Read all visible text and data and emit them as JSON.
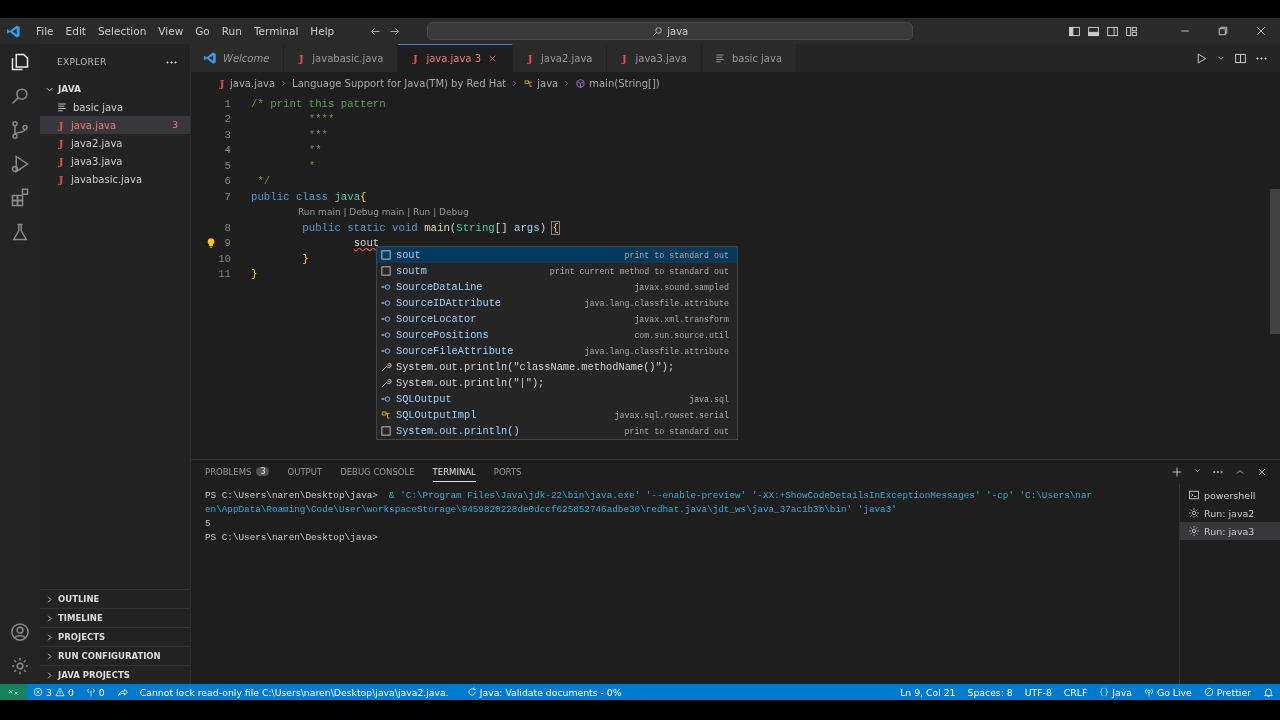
{
  "title_bar": {
    "menu": [
      "File",
      "Edit",
      "Selection",
      "View",
      "Go",
      "Run",
      "Terminal",
      "Help"
    ],
    "search": {
      "value": "java"
    }
  },
  "activity_bar": [
    {
      "selected": true
    },
    {
      "selected": false
    },
    {
      "selected": false
    },
    {
      "selected": false
    },
    {
      "selected": false
    },
    {
      "selected": false
    }
  ],
  "sidebar": {
    "title": "EXPLORER",
    "folder": {
      "name": "JAVA",
      "expanded": true,
      "children": [
        {
          "name": "basic java",
          "kind": "text",
          "selected": false,
          "error": false
        },
        {
          "name": "java.java",
          "kind": "java",
          "glyph": "J",
          "selected": true,
          "error": true,
          "badge": "3"
        },
        {
          "name": "java2.java",
          "kind": "java",
          "glyph": "J",
          "selected": false,
          "error": false
        },
        {
          "name": "java3.java",
          "kind": "java",
          "glyph": "J",
          "selected": false,
          "error": false
        },
        {
          "name": "javabasic.java",
          "kind": "java",
          "glyph": "J",
          "selected": false,
          "error": false
        }
      ]
    },
    "sections": [
      {
        "label": "OUTLINE",
        "expanded": false
      },
      {
        "label": "TIMELINE",
        "expanded": false
      },
      {
        "label": "PROJECTS",
        "expanded": false
      },
      {
        "label": "RUN CONFIGURATION",
        "expanded": false
      },
      {
        "label": "JAVA PROJECTS",
        "expanded": false
      }
    ]
  },
  "tabs": [
    {
      "label": "Welcome",
      "kind": "welcome",
      "selected": false,
      "error": false,
      "preview": true
    },
    {
      "label": "javabasic.java",
      "kind": "java",
      "glyph": "J",
      "selected": false,
      "error": false,
      "preview": false
    },
    {
      "label": "java.java",
      "kind": "java",
      "glyph": "J",
      "selected": true,
      "error": true,
      "preview": false,
      "badge": "3"
    },
    {
      "label": "java2.java",
      "kind": "java",
      "glyph": "J",
      "selected": false,
      "error": false,
      "preview": false
    },
    {
      "label": "java3.java",
      "kind": "java",
      "glyph": "J",
      "selected": false,
      "error": false,
      "preview": false
    },
    {
      "label": "basic java",
      "kind": "text",
      "selected": false,
      "error": false,
      "preview": false
    }
  ],
  "breadcrumb": [
    {
      "text": "java.java",
      "kind": "java",
      "glyph": "J"
    },
    {
      "text": "Language Support for Java(TM) by Red Hat"
    },
    {
      "text": "java",
      "kind": "class"
    },
    {
      "text": "main(String[])",
      "kind": "method"
    }
  ],
  "code": [
    {
      "number": "1",
      "tokens": [
        {
          "kind": "comment",
          "text": "/* print this pattern"
        }
      ]
    },
    {
      "number": "2",
      "tokens": [
        {
          "kind": "comment",
          "text": "         ****"
        }
      ]
    },
    {
      "number": "3",
      "tokens": [
        {
          "kind": "comment",
          "text": "         ***"
        }
      ]
    },
    {
      "number": "4",
      "tokens": [
        {
          "kind": "comment",
          "text": "         **"
        }
      ]
    },
    {
      "number": "5",
      "tokens": [
        {
          "kind": "comment",
          "text": "         *"
        }
      ]
    },
    {
      "number": "6",
      "tokens": [
        {
          "kind": "comment",
          "text": " */"
        }
      ]
    },
    {
      "number": "7",
      "tokens": [
        {
          "kind": "keyword",
          "text": "public class "
        },
        {
          "kind": "type",
          "text": "java"
        },
        {
          "kind": "bracket",
          "text": "{"
        }
      ]
    },
    {
      "number": "8",
      "codelens": "Run main | Debug main | Run | Debug",
      "tokens": [
        {
          "kind": "keyword",
          "text": "        public static void "
        },
        {
          "kind": "function",
          "text": "main"
        },
        {
          "kind": "plain",
          "text": "("
        },
        {
          "kind": "class",
          "text": "String"
        },
        {
          "kind": "plain",
          "text": "[] "
        },
        {
          "kind": "variable",
          "text": "args"
        },
        {
          "kind": "plain",
          "text": ") "
        },
        {
          "kind": "match",
          "text": "{"
        }
      ]
    },
    {
      "number": "9",
      "lightbulb": true,
      "tokens": [
        {
          "kind": "error",
          "text": "                sout"
        }
      ]
    },
    {
      "number": "10",
      "tokens": [
        {
          "kind": "bracket",
          "text": "        }"
        }
      ]
    },
    {
      "number": "11",
      "tokens": [
        {
          "kind": "bracket",
          "text": "}"
        }
      ]
    }
  ],
  "suggestions": [
    {
      "kind": "snippet",
      "label": "sout",
      "detail": "print to standard out",
      "selected": true
    },
    {
      "kind": "snippet",
      "label": "soutm",
      "detail": "print current method to standard out",
      "selected": false
    },
    {
      "kind": "interface",
      "label": "SourceDataLine",
      "detail": "javax.sound.sampled",
      "selected": false
    },
    {
      "kind": "interface",
      "label": "SourceIDAttribute",
      "detail": "java.lang.classfile.attribute",
      "selected": false
    },
    {
      "kind": "interface",
      "label": "SourceLocator",
      "detail": "javax.xml.transform",
      "selected": false
    },
    {
      "kind": "interface",
      "label": "SourcePositions",
      "detail": "com.sun.source.util",
      "selected": false
    },
    {
      "kind": "interface",
      "label": "SourceFileAttribute",
      "detail": "java.lang.classfile.attribute",
      "selected": false
    },
    {
      "kind": "wrench",
      "label": "System.out.println(\"className.methodName()\");",
      "selected": false
    },
    {
      "kind": "wrench",
      "label": "System.out.println(\"|\");",
      "selected": false
    },
    {
      "kind": "interface",
      "label": "SQLOutput",
      "detail": "java.sql",
      "selected": false
    },
    {
      "kind": "class",
      "label": "SQLOutputImpl",
      "detail": "javax.sql.rowset.serial",
      "selected": false
    },
    {
      "kind": "snippet",
      "label": "System.out.println()",
      "detail": "print to standard out",
      "selected": false
    }
  ],
  "panel": {
    "tabs": [
      {
        "label": "PROBLEMS",
        "badge": "3",
        "selected": false
      },
      {
        "label": "OUTPUT",
        "selected": false
      },
      {
        "label": "DEBUG CONSOLE",
        "selected": false
      },
      {
        "label": "TERMINAL",
        "selected": true
      },
      {
        "label": "PORTS",
        "selected": false
      }
    ],
    "terminal": [
      [
        {
          "kind": "prompt",
          "text": "PS C:\\Users\\naren\\Desktop\\java> "
        },
        {
          "kind": "command",
          "text": " & 'C:\\Program Files\\Java\\jdk-22\\bin\\java.exe' '--enable-preview' '-XX:+ShowCodeDetailsInExceptionMessages' '-cp' 'C:\\Users\\nar"
        }
      ],
      [
        {
          "kind": "command",
          "text": "en\\AppData\\Roaming\\Code\\User\\workspaceStorage\\9459820228de0dccf625852746adbe30\\redhat.java\\jdt_ws\\java_37ac1b3b\\bin' 'java3'"
        }
      ],
      [
        {
          "kind": "prompt",
          "text": "5"
        }
      ],
      [
        {
          "kind": "prompt",
          "text": "PS C:\\Users\\naren\\Desktop\\java>"
        }
      ]
    ],
    "sessions": [
      {
        "label": "powershell",
        "kind": "shell",
        "selected": false
      },
      {
        "label": "Run: java2",
        "kind": "run",
        "selected": false
      },
      {
        "label": "Run: java3",
        "kind": "run",
        "selected": true
      }
    ]
  },
  "status_bar": {
    "left": [
      {
        "kind": "remote"
      },
      {
        "kind": "problems",
        "errors": "3",
        "warnings": "0"
      },
      {
        "kind": "ports",
        "text": "0"
      },
      {
        "kind": "share"
      },
      {
        "kind": "message",
        "text": "Cannot lock read-only file C:\\Users\\naren\\Desktop\\java\\java2.java."
      },
      {
        "kind": "progress",
        "text": "Java: Validate documents - 0%"
      }
    ],
    "right": [
      {
        "kind": "text",
        "text": "Ln 9, Col 21"
      },
      {
        "kind": "text",
        "text": "Spaces: 8"
      },
      {
        "kind": "text",
        "text": "UTF-8"
      },
      {
        "kind": "text",
        "text": "CRLF"
      },
      {
        "kind": "language",
        "text": "Java"
      },
      {
        "kind": "golive",
        "text": "Go Live"
      },
      {
        "kind": "prettier",
        "text": "Prettier"
      },
      {
        "kind": "bell"
      }
    ]
  }
}
